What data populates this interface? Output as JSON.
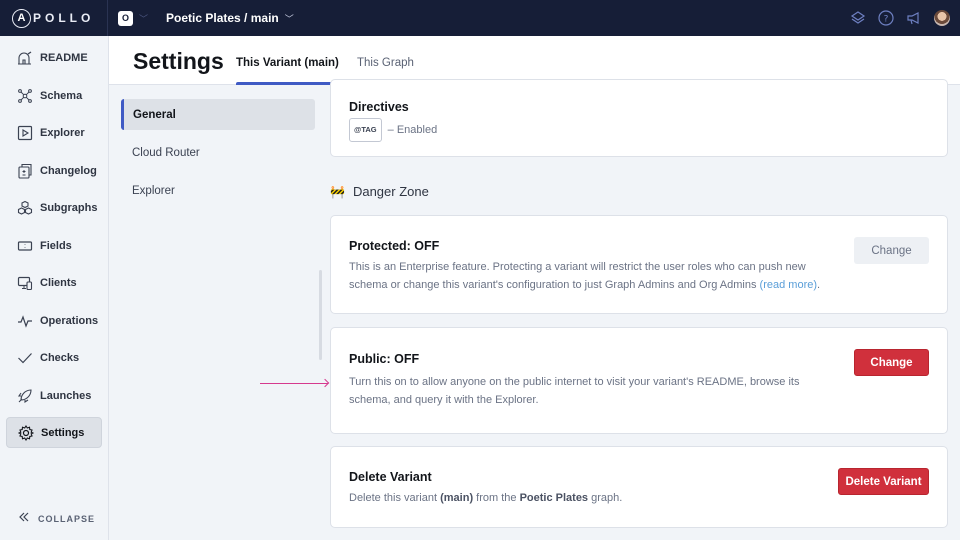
{
  "topbar": {
    "logo_letter": "A",
    "logo_text": "POLLO",
    "org_initial": "O",
    "graph_name": "Poetic Plates / main",
    "icons": [
      "stack-icon",
      "help-icon",
      "megaphone-icon",
      "user-avatar"
    ]
  },
  "sidebar": {
    "items": [
      {
        "label": "README",
        "icon": "observatory-icon"
      },
      {
        "label": "Schema",
        "icon": "schema-graph-icon"
      },
      {
        "label": "Explorer",
        "icon": "play-icon"
      },
      {
        "label": "Changelog",
        "icon": "changelog-icon"
      },
      {
        "label": "Subgraphs",
        "icon": "subgraphs-icon"
      },
      {
        "label": "Fields",
        "icon": "fields-icon"
      },
      {
        "label": "Clients",
        "icon": "clients-icon"
      },
      {
        "label": "Operations",
        "icon": "pulse-icon"
      },
      {
        "label": "Checks",
        "icon": "checkmark-icon"
      },
      {
        "label": "Launches",
        "icon": "rocket-icon"
      },
      {
        "label": "Settings",
        "icon": "gear-icon",
        "active": true
      }
    ],
    "collapse_label": "COLLAPSE"
  },
  "header": {
    "title": "Settings",
    "tabs": [
      {
        "label": "This Variant (main)",
        "active": true
      },
      {
        "label": "This Graph",
        "active": false
      }
    ]
  },
  "subnav": {
    "items": [
      {
        "label": "General",
        "active": true
      },
      {
        "label": "Cloud Router",
        "active": false
      },
      {
        "label": "Explorer",
        "active": false
      }
    ]
  },
  "main": {
    "directives": {
      "title": "Directives",
      "tag": "@TAG",
      "status": "– Enabled"
    },
    "danger_zone": {
      "emoji": "🚧",
      "label": "Danger Zone"
    },
    "protected": {
      "title": "Protected: OFF",
      "desc_line1": "This is an Enterprise feature. Protecting a variant will restrict the user roles who can push new",
      "desc_line2": "schema or change this variant's configuration to just Graph Admins and Org Admins ",
      "read_more": "(read more)",
      "desc_end": ".",
      "button": "Change"
    },
    "public": {
      "title": "Public: OFF",
      "desc_line1": "Turn this on to allow anyone on the public internet to visit your variant's README, browse its",
      "desc_line2": "schema, and query it with the Explorer.",
      "button": "Change"
    },
    "delete": {
      "title": "Delete Variant",
      "desc_a": "Delete this variant ",
      "desc_variant": "(main)",
      "desc_b": " from the ",
      "desc_graph": "Poetic Plates",
      "desc_c": " graph.",
      "button": "Delete Variant"
    }
  },
  "colors": {
    "topbar_bg": "#161e37",
    "accent": "#3f5ac4",
    "danger": "#d0303c",
    "link": "#5a9ed8",
    "annotation_arrow": "#d6398e"
  }
}
